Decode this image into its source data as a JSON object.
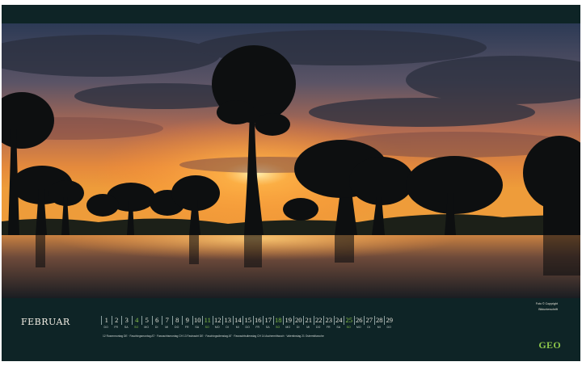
{
  "calendar": {
    "month": "FEBRUAR",
    "days": [
      {
        "num": "1",
        "wd": "DO"
      },
      {
        "num": "2",
        "wd": "FR"
      },
      {
        "num": "3",
        "wd": "SA"
      },
      {
        "num": "4",
        "wd": "SO",
        "highlight": true
      },
      {
        "num": "5",
        "wd": "MO"
      },
      {
        "num": "6",
        "wd": "DI"
      },
      {
        "num": "7",
        "wd": "MI"
      },
      {
        "num": "8",
        "wd": "DO"
      },
      {
        "num": "9",
        "wd": "FR"
      },
      {
        "num": "10",
        "wd": "SA"
      },
      {
        "num": "11",
        "wd": "SO",
        "highlight": true
      },
      {
        "num": "12",
        "wd": "MO"
      },
      {
        "num": "13",
        "wd": "DI"
      },
      {
        "num": "14",
        "wd": "MI"
      },
      {
        "num": "15",
        "wd": "DO"
      },
      {
        "num": "16",
        "wd": "FR"
      },
      {
        "num": "17",
        "wd": "SA"
      },
      {
        "num": "18",
        "wd": "SO",
        "highlight": true
      },
      {
        "num": "19",
        "wd": "MO"
      },
      {
        "num": "20",
        "wd": "DI"
      },
      {
        "num": "21",
        "wd": "MI"
      },
      {
        "num": "22",
        "wd": "DO"
      },
      {
        "num": "23",
        "wd": "FR"
      },
      {
        "num": "24",
        "wd": "SA"
      },
      {
        "num": "25",
        "wd": "SO",
        "highlight": true
      },
      {
        "num": "26",
        "wd": "MO"
      },
      {
        "num": "27",
        "wd": "DI"
      },
      {
        "num": "28",
        "wd": "MI"
      },
      {
        "num": "29",
        "wd": "DO"
      }
    ],
    "holidays": "12 Rosenmontag DE · Faschingsmontag AT · Fasnachtsmontag CH  13 Fastnacht DE · Faschingsdienstag AT · Fasnachtsdienstag CH  14 Aschermittwoch · Valentinstag  21 Ostermittwoche"
  },
  "credit": {
    "line1": "Foto © Copyright",
    "line2": "Bildunterschrift"
  },
  "brand": {
    "logo": "GEO",
    "accent": "#8cc54a",
    "background": "#0e2426"
  }
}
